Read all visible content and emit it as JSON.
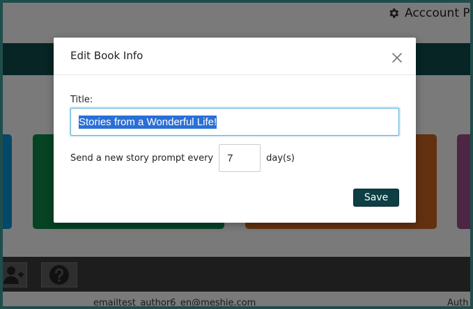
{
  "header": {
    "account_label": "Acccount P",
    "icon": "gear-icon"
  },
  "footer": {
    "email_text": "emailtest_author6_en@meshie.com",
    "right_text": "Auth"
  },
  "bottom_bar": {
    "buttons": [
      {
        "icon": "add-user-icon"
      },
      {
        "icon": "help-icon"
      }
    ]
  },
  "modal": {
    "title": "Edit Book Info",
    "close_icon": "close-icon",
    "title_label": "Title:",
    "title_value": "Stories from a Wonderful Life!",
    "prompt_prefix": "Send a new story prompt every",
    "days_value": "7",
    "prompt_suffix": "day(s)",
    "save_label": "Save"
  },
  "colors": {
    "teal_bar": "#0d4a48",
    "card_blue": "#0a91d0",
    "card_green": "#0d874b",
    "card_orange": "#c7621e",
    "card_purple": "#9a4a8a",
    "save_button": "#0d3f44",
    "selection": "#2a6fd6"
  }
}
